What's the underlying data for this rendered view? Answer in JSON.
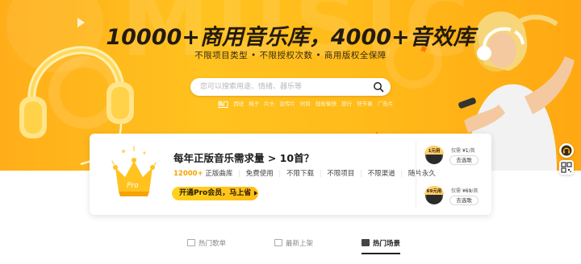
{
  "hero": {
    "bg_word": "MUSIC",
    "title": "10000+商用音乐库，4000+音效库",
    "subtitle": "不限项目类型 • 不限授权次数 • 商用版权全保障",
    "search": {
      "placeholder": "您可以搜索用途、情绪、器乐等"
    },
    "hot_tags": [
      "热门",
      "西班",
      "格子",
      "片头",
      "宣传片",
      "时尚",
      "轻松愉快",
      "旅行",
      "快节奏",
      "广告片"
    ]
  },
  "card": {
    "badge": "Pro",
    "title": "每年正版音乐需求量 > 10首？",
    "features": {
      "highlight": "12000+",
      "items": [
        "正版曲库",
        "免费使用",
        "不限下载",
        "不限项目",
        "不限渠道",
        "随片永久"
      ]
    },
    "join_label": "开通Pro会员，马上省",
    "offers": [
      {
        "disc_label": "1元用",
        "price_prefix": "仅需",
        "price": "¥1",
        "price_unit": "/首",
        "buy_label": "去选歌"
      },
      {
        "disc_label": "69元用",
        "price_prefix": "仅需",
        "price": "¥69",
        "price_unit": "/首",
        "buy_label": "去选歌"
      }
    ]
  },
  "tabs": [
    {
      "label": "热门歌单"
    },
    {
      "label": "最新上架"
    },
    {
      "label": "热门场景"
    }
  ],
  "colors": {
    "accent": "#ffc21f",
    "accent_text": "#f5a400"
  }
}
